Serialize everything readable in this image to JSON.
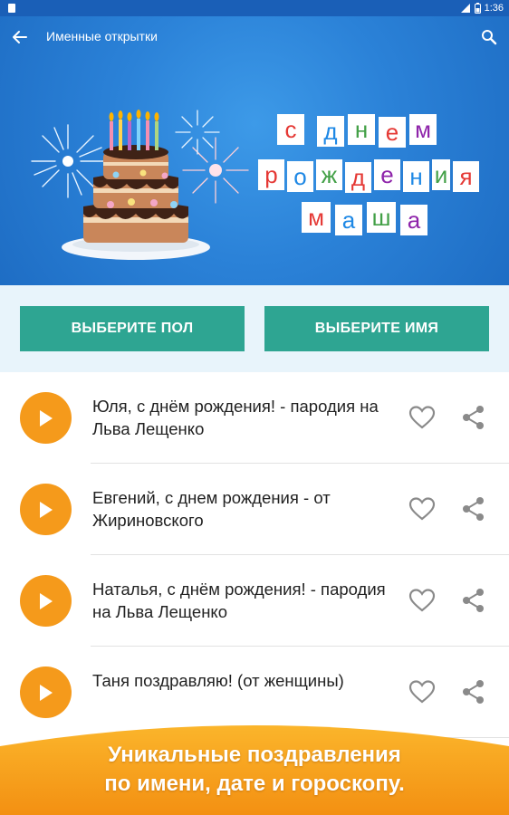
{
  "status_bar": {
    "time": "1:36",
    "icons": [
      "notification-icon",
      "signal-icon",
      "battery-icon"
    ]
  },
  "toolbar": {
    "title": "Именные открытки",
    "back_icon": "arrow-back-icon",
    "search_icon": "search-icon"
  },
  "hero": {
    "greeting_words": [
      {
        "letters": [
          "с",
          "д",
          "н",
          "е",
          "м"
        ]
      },
      {
        "letters": [
          "р",
          "о",
          "ж",
          "д",
          "е",
          "н",
          "и",
          "я"
        ]
      },
      {
        "letters": [
          "м",
          "а",
          "ш",
          "а"
        ]
      }
    ]
  },
  "buttons": {
    "choose_gender": "ВЫБЕРИТЕ ПОЛ",
    "choose_name": "ВЫБЕРИТЕ ИМЯ"
  },
  "list": {
    "items": [
      {
        "title": "Юля, с днём рождения! - пародия на Льва Лещенко"
      },
      {
        "title": "Евгений, с днем рождения - от Жириновского"
      },
      {
        "title": "Наталья, с днём рождения! - пародия на Льва Лещенко"
      },
      {
        "title": "Таня поздравляю! (от женщины)"
      }
    ]
  },
  "promo": {
    "line1": "Уникальные поздравления",
    "line2": "по имени, дате и гороскопу."
  },
  "colors": {
    "status_bar": "#1a5fb7",
    "hero_blue": "#2b82d8",
    "button_teal": "#2ea592",
    "play_orange": "#f59a1b",
    "promo_orange": "#f7a11a"
  }
}
